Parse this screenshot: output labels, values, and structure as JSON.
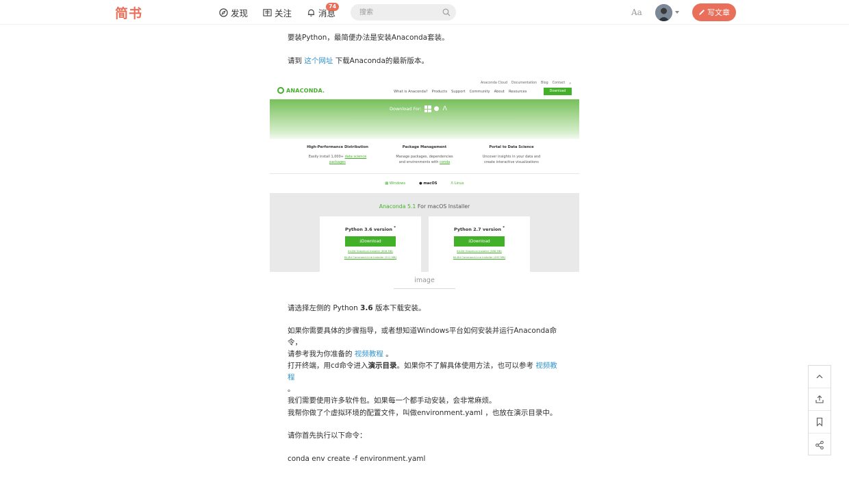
{
  "nav": {
    "logo": "简书",
    "discover": "发现",
    "follow": "关注",
    "messages": "消息",
    "message_count": "74",
    "search_placeholder": "搜索",
    "font_toggle": "Aa",
    "write": "写文章"
  },
  "article": {
    "p1": "要装Python，最简便办法是安装Anaconda套装。",
    "p2_pre": "请到",
    "p2_link": "这个网址",
    "p2_post": "下载Anaconda的最新版本。",
    "caption": "image",
    "p3_pre": "请选择左侧的 Python ",
    "p3_bold": "3.6",
    "p3_post": " 版本下载安装。",
    "p4_line1": "如果你需要具体的步骤指导，或者想知道Windows平台如何安装并运行Anaconda命令，",
    "p4_pre": "请参考我为你准备的",
    "p4_link": "视频教程",
    "p4_post": "。",
    "p5_pre": "打开终端，用cd命令进入",
    "p5_bold": "演示目录",
    "p5_mid": "。如果你不了解具体使用方法，也可以参考",
    "p5_link": "视频教程",
    "p5_end": "。",
    "p6": "我们需要使用许多软件包。如果每一个都手动安装，会非常麻烦。",
    "p7": "我帮你做了个虚拟环境的配置文件，叫做environment.yaml ，也放在演示目录中。",
    "p8": "请你首先执行以下命令：",
    "p9": "conda env create -f environment.yaml"
  },
  "screenshot": {
    "top_links": [
      "Anaconda Cloud",
      "Documentation",
      "Blog",
      "Contact"
    ],
    "logo": "ANACONDA.",
    "menu": [
      "What is Anaconda?",
      "Products",
      "Support",
      "Community",
      "About",
      "Resources"
    ],
    "download_btn": "Download",
    "download_for": "Download For:",
    "features": [
      {
        "title": "High-Performance Distribution",
        "line1_pre": "Easily install 1,000+ ",
        "line1_link": "data science",
        "line2_link": "packages"
      },
      {
        "title": "Package Management",
        "line1": "Manage packages, dependencies",
        "line2_pre": "and environments with ",
        "line2_link": "conda"
      },
      {
        "title": "Portal to Data Science",
        "line1": "Uncover insights in your data and",
        "line2": "create interactive visualizations"
      }
    ],
    "os_tabs": [
      "Windows",
      "macOS",
      "Linux"
    ],
    "installer_title_green": "Anaconda 5.1",
    "installer_title_rest": " For macOS Installer",
    "cards": [
      {
        "title": "Python 3.6 version",
        "btn": "Download",
        "link1": "64-Bit Graphical Installer (606 MB)",
        "link2": "64-Bit Command-Line Installer (511 MB)"
      },
      {
        "title": "Python 2.7 version",
        "btn": "Download",
        "link1": "64-Bit Graphical Installer (588 MB)",
        "link2": "64-Bit Command-Line Installer (493 MB)"
      }
    ]
  },
  "colors": {
    "brand": "#ea6f5a",
    "link": "#3194d0",
    "anaconda_green": "#43b02a"
  }
}
